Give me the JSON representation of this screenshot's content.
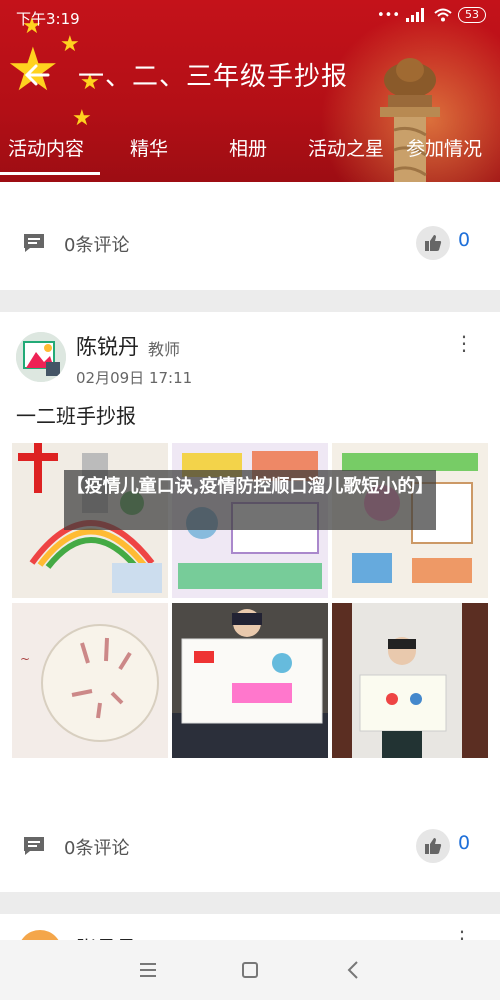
{
  "status_bar": {
    "time": "下午3:19",
    "battery": "53"
  },
  "header": {
    "title": "一、二、三年级手抄报"
  },
  "tabs": [
    {
      "label": "活动内容",
      "active": true
    },
    {
      "label": "精华"
    },
    {
      "label": "相册"
    },
    {
      "label": "活动之星"
    },
    {
      "label": "参加情况"
    }
  ],
  "prev_post": {
    "comments": "0条评论",
    "likes": "0"
  },
  "post": {
    "author": "陈锐丹",
    "role": "教师",
    "date": "02月09日 17:11",
    "text": "一二班手抄报",
    "overlay": "【疫情儿童口诀,疫情防控顺口溜儿歌短小的】",
    "comments": "0条评论",
    "likes": "0",
    "photos": [
      "handmade-poster",
      "handmade-poster",
      "handmade-poster",
      "hand-drawing",
      "child-holding-poster",
      "child-holding-poster"
    ]
  },
  "next_post": {
    "author": "张月月",
    "role": "教师"
  },
  "colors": {
    "brand_red": "#c4121a",
    "accent_blue": "#1e6fd9",
    "star_yellow": "#ffd21f"
  }
}
